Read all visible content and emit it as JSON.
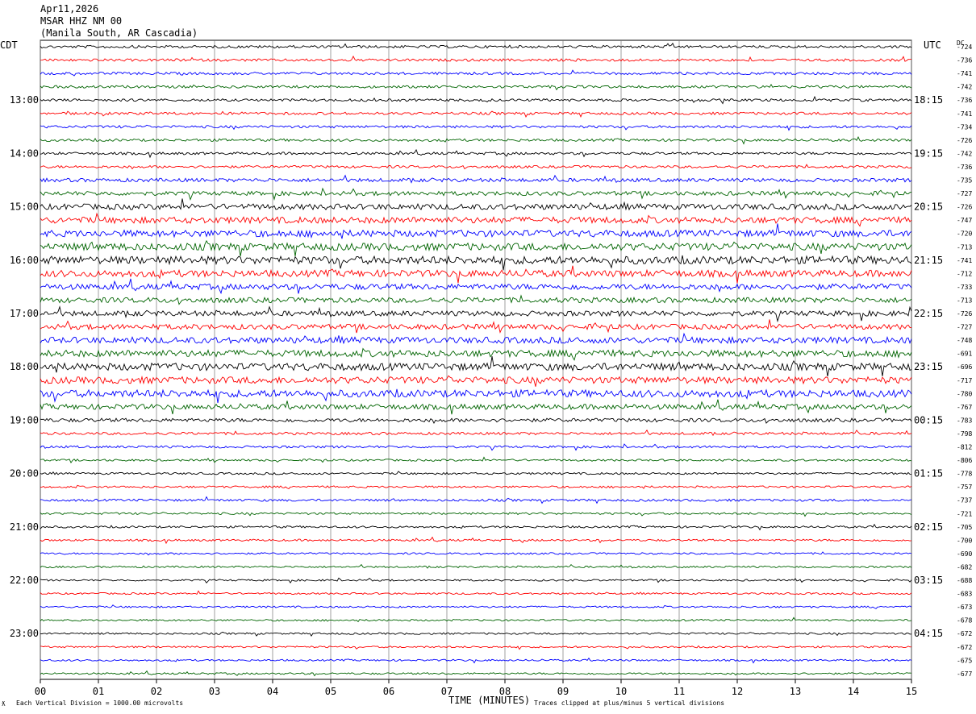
{
  "header": {
    "date": "Apr11,2026",
    "station": "MSAR HHZ NM 00",
    "location": "(Manila South, AR Cascadia)"
  },
  "left_zone": "CDT",
  "right_zone": "UTC",
  "dc_label": "DC",
  "footer": {
    "scale": "Each Vertical Division = 1000.00 microvolts",
    "clip": "Traces clipped at plus/minus 5 vertical divisions",
    "mark": "ƛ"
  },
  "chart_data": {
    "type": "line",
    "title": "",
    "xlabel": "TIME (MINUTES)",
    "xlim": [
      0,
      15
    ],
    "x_ticks": [
      "00",
      "01",
      "02",
      "03",
      "04",
      "05",
      "06",
      "07",
      "08",
      "09",
      "10",
      "11",
      "12",
      "13",
      "14",
      "15"
    ],
    "left_labels": [
      "13:00",
      "14:00",
      "15:00",
      "16:00",
      "17:00",
      "18:00",
      "19:00",
      "20:00",
      "21:00",
      "22:00",
      "23:00"
    ],
    "right_labels": [
      "18:15",
      "19:15",
      "20:15",
      "21:15",
      "22:15",
      "23:15",
      "00:15",
      "01:15",
      "02:15",
      "03:15",
      "04:15"
    ],
    "trace_colors": [
      "#000000",
      "#ff0000",
      "#0000ff",
      "#006400"
    ],
    "dc_offsets": [
      "-724",
      "-736",
      "-741",
      "-742",
      "-736",
      "-741",
      "-734",
      "-726",
      "-742",
      "-736",
      "-735",
      "-727",
      "-726",
      "-747",
      "-720",
      "-713",
      "-741",
      "-712",
      "-733",
      "-713",
      "-726",
      "-727",
      "-748",
      "-691",
      "-696",
      "-717",
      "-780",
      "-767",
      "-783",
      "-798",
      "-812",
      "-806",
      "-778",
      "-757",
      "-737",
      "-721",
      "-705",
      "-700",
      "-690",
      "-682",
      "-688",
      "-683",
      "-673",
      "-678",
      "-672",
      "-672",
      "-675",
      "-677"
    ],
    "trace_amplitude": [
      1,
      1,
      1,
      1,
      1,
      1,
      1,
      1,
      1,
      1,
      1.4,
      1.6,
      2.2,
      2.4,
      2.6,
      2.8,
      3,
      2.6,
      2.2,
      2,
      2,
      2,
      2.4,
      2.6,
      2.8,
      2.6,
      2.8,
      2,
      1.4,
      1,
      0.9,
      0.8,
      0.8,
      0.8,
      0.9,
      0.8,
      0.8,
      0.8,
      0.7,
      0.7,
      0.7,
      0.7,
      0.7,
      0.7,
      0.7,
      0.7,
      0.7,
      0.7
    ]
  }
}
